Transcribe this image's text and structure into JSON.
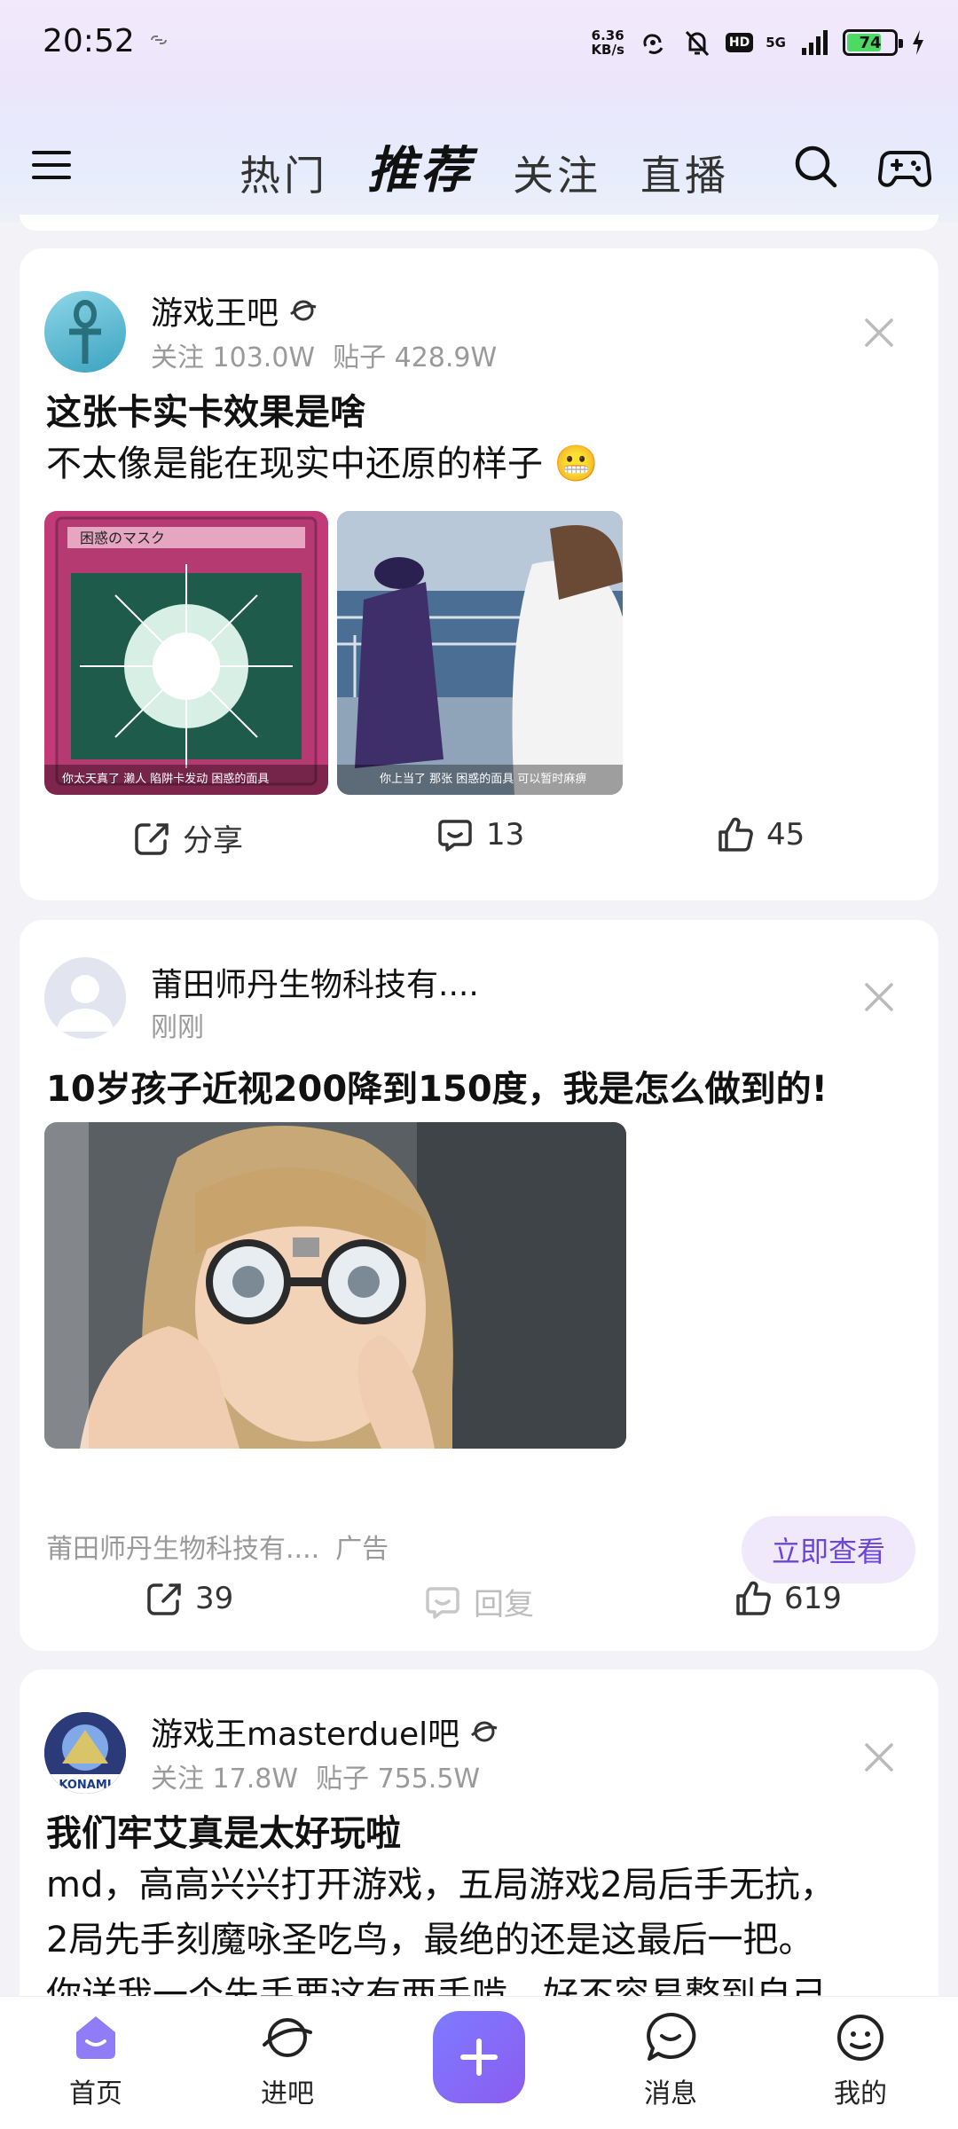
{
  "status_bar": {
    "time": "20:52",
    "net_speed_value": "6.36",
    "net_speed_unit": "KB/s",
    "hd": "HD",
    "network": "5G",
    "battery": "74",
    "battery_fraction": 0.74
  },
  "header": {
    "tabs": [
      {
        "label": "热门"
      },
      {
        "label": "推荐"
      },
      {
        "label": "关注"
      },
      {
        "label": "直播"
      }
    ],
    "active_tab": "推荐"
  },
  "posts": [
    {
      "forum": "游戏王吧",
      "follow": "关注 103.0W",
      "posts_count": "贴子 428.9W",
      "title": "这张卡实卡效果是啥",
      "body": "不太像是能在现实中还原的样子 😬",
      "images": [
        {
          "caption": "你太天真了 濑人 陷阱卡发动 困惑的面具",
          "card_name": "困惑のマスク"
        },
        {
          "caption": "你上当了 那张 困惑的面具 可以暂时麻痹"
        }
      ],
      "share_label": "分享",
      "comments": "13",
      "likes": "45"
    },
    {
      "forum": "莆田师丹生物科技有....",
      "time": "刚刚",
      "title": "10岁孩子近视200降到150度，我是怎么做到的!",
      "advertiser": "莆田师丹生物科技有....",
      "ad_label": "广告",
      "cta": "立即查看",
      "shares": "39",
      "reply_label": "回复",
      "likes": "619"
    },
    {
      "forum": "游戏王masterduel吧",
      "follow": "关注 17.8W",
      "posts_count": "贴子 755.5W",
      "title": "我们牢艾真是太好玩啦",
      "body_line1": "md，高高兴兴打开游戏，五局游戏2局后手无抗，",
      "body_line2": "2局先手刻魔咏圣吃鸟，最绝的还是这最后一把。",
      "body_line3": "你送我一个先手要这有两手啃，好不容易整到自己",
      "avatar_text": "KONAMI"
    }
  ],
  "bottom_nav": {
    "items": [
      {
        "label": "首页"
      },
      {
        "label": "进吧"
      },
      {
        "label": "消息"
      },
      {
        "label": "我的"
      }
    ]
  },
  "colors": {
    "accent": "#7d6cf5",
    "cta_bg": "#efe9fb",
    "cta_text": "#6b46d8",
    "meta_gray": "#9a9a9a"
  }
}
